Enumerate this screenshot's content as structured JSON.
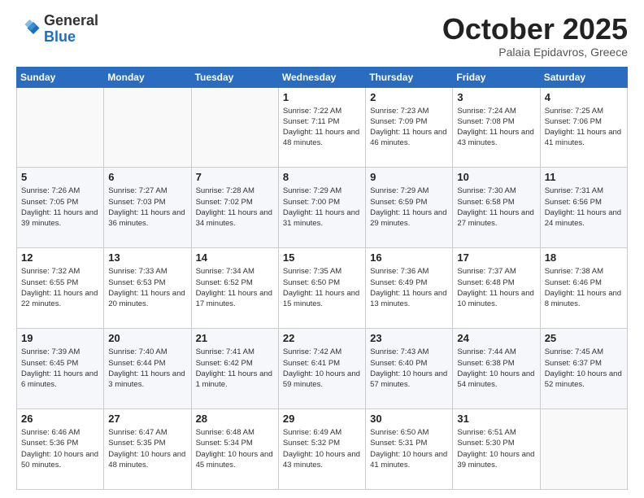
{
  "header": {
    "logo_general": "General",
    "logo_blue": "Blue",
    "month": "October 2025",
    "location": "Palaia Epidavros, Greece"
  },
  "days_of_week": [
    "Sunday",
    "Monday",
    "Tuesday",
    "Wednesday",
    "Thursday",
    "Friday",
    "Saturday"
  ],
  "weeks": [
    [
      {
        "day": "",
        "info": ""
      },
      {
        "day": "",
        "info": ""
      },
      {
        "day": "",
        "info": ""
      },
      {
        "day": "1",
        "info": "Sunrise: 7:22 AM\nSunset: 7:11 PM\nDaylight: 11 hours and 48 minutes."
      },
      {
        "day": "2",
        "info": "Sunrise: 7:23 AM\nSunset: 7:09 PM\nDaylight: 11 hours and 46 minutes."
      },
      {
        "day": "3",
        "info": "Sunrise: 7:24 AM\nSunset: 7:08 PM\nDaylight: 11 hours and 43 minutes."
      },
      {
        "day": "4",
        "info": "Sunrise: 7:25 AM\nSunset: 7:06 PM\nDaylight: 11 hours and 41 minutes."
      }
    ],
    [
      {
        "day": "5",
        "info": "Sunrise: 7:26 AM\nSunset: 7:05 PM\nDaylight: 11 hours and 39 minutes."
      },
      {
        "day": "6",
        "info": "Sunrise: 7:27 AM\nSunset: 7:03 PM\nDaylight: 11 hours and 36 minutes."
      },
      {
        "day": "7",
        "info": "Sunrise: 7:28 AM\nSunset: 7:02 PM\nDaylight: 11 hours and 34 minutes."
      },
      {
        "day": "8",
        "info": "Sunrise: 7:29 AM\nSunset: 7:00 PM\nDaylight: 11 hours and 31 minutes."
      },
      {
        "day": "9",
        "info": "Sunrise: 7:29 AM\nSunset: 6:59 PM\nDaylight: 11 hours and 29 minutes."
      },
      {
        "day": "10",
        "info": "Sunrise: 7:30 AM\nSunset: 6:58 PM\nDaylight: 11 hours and 27 minutes."
      },
      {
        "day": "11",
        "info": "Sunrise: 7:31 AM\nSunset: 6:56 PM\nDaylight: 11 hours and 24 minutes."
      }
    ],
    [
      {
        "day": "12",
        "info": "Sunrise: 7:32 AM\nSunset: 6:55 PM\nDaylight: 11 hours and 22 minutes."
      },
      {
        "day": "13",
        "info": "Sunrise: 7:33 AM\nSunset: 6:53 PM\nDaylight: 11 hours and 20 minutes."
      },
      {
        "day": "14",
        "info": "Sunrise: 7:34 AM\nSunset: 6:52 PM\nDaylight: 11 hours and 17 minutes."
      },
      {
        "day": "15",
        "info": "Sunrise: 7:35 AM\nSunset: 6:50 PM\nDaylight: 11 hours and 15 minutes."
      },
      {
        "day": "16",
        "info": "Sunrise: 7:36 AM\nSunset: 6:49 PM\nDaylight: 11 hours and 13 minutes."
      },
      {
        "day": "17",
        "info": "Sunrise: 7:37 AM\nSunset: 6:48 PM\nDaylight: 11 hours and 10 minutes."
      },
      {
        "day": "18",
        "info": "Sunrise: 7:38 AM\nSunset: 6:46 PM\nDaylight: 11 hours and 8 minutes."
      }
    ],
    [
      {
        "day": "19",
        "info": "Sunrise: 7:39 AM\nSunset: 6:45 PM\nDaylight: 11 hours and 6 minutes."
      },
      {
        "day": "20",
        "info": "Sunrise: 7:40 AM\nSunset: 6:44 PM\nDaylight: 11 hours and 3 minutes."
      },
      {
        "day": "21",
        "info": "Sunrise: 7:41 AM\nSunset: 6:42 PM\nDaylight: 11 hours and 1 minute."
      },
      {
        "day": "22",
        "info": "Sunrise: 7:42 AM\nSunset: 6:41 PM\nDaylight: 10 hours and 59 minutes."
      },
      {
        "day": "23",
        "info": "Sunrise: 7:43 AM\nSunset: 6:40 PM\nDaylight: 10 hours and 57 minutes."
      },
      {
        "day": "24",
        "info": "Sunrise: 7:44 AM\nSunset: 6:38 PM\nDaylight: 10 hours and 54 minutes."
      },
      {
        "day": "25",
        "info": "Sunrise: 7:45 AM\nSunset: 6:37 PM\nDaylight: 10 hours and 52 minutes."
      }
    ],
    [
      {
        "day": "26",
        "info": "Sunrise: 6:46 AM\nSunset: 5:36 PM\nDaylight: 10 hours and 50 minutes."
      },
      {
        "day": "27",
        "info": "Sunrise: 6:47 AM\nSunset: 5:35 PM\nDaylight: 10 hours and 48 minutes."
      },
      {
        "day": "28",
        "info": "Sunrise: 6:48 AM\nSunset: 5:34 PM\nDaylight: 10 hours and 45 minutes."
      },
      {
        "day": "29",
        "info": "Sunrise: 6:49 AM\nSunset: 5:32 PM\nDaylight: 10 hours and 43 minutes."
      },
      {
        "day": "30",
        "info": "Sunrise: 6:50 AM\nSunset: 5:31 PM\nDaylight: 10 hours and 41 minutes."
      },
      {
        "day": "31",
        "info": "Sunrise: 6:51 AM\nSunset: 5:30 PM\nDaylight: 10 hours and 39 minutes."
      },
      {
        "day": "",
        "info": ""
      }
    ]
  ]
}
